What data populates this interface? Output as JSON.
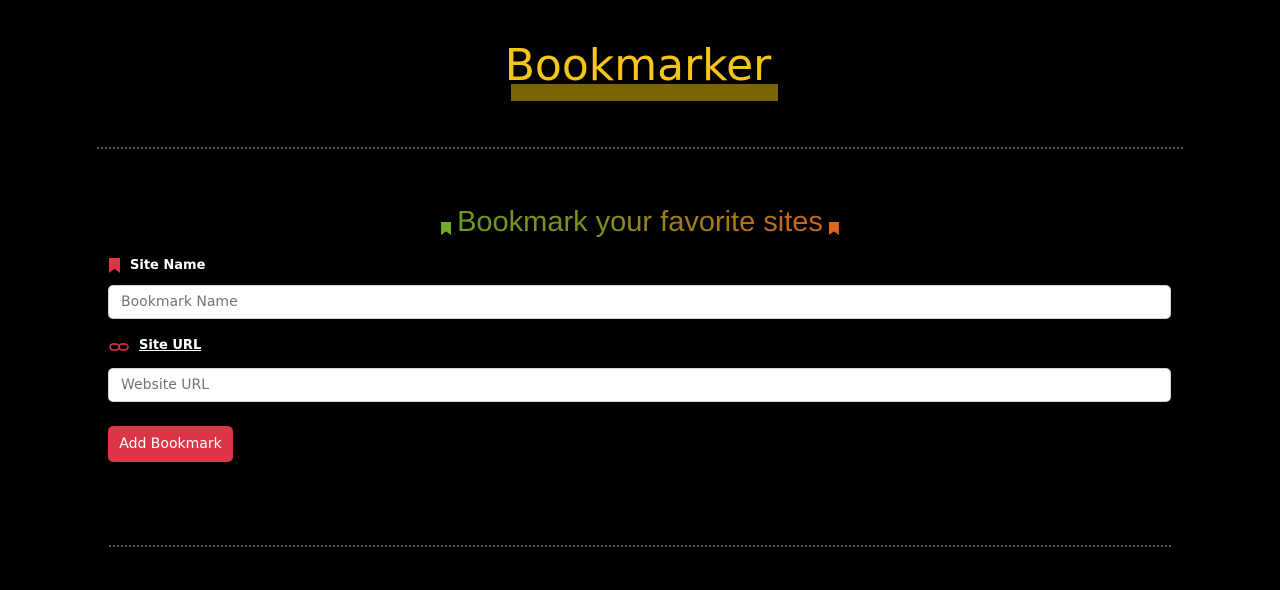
{
  "header": {
    "brand": "Bookmarker"
  },
  "form": {
    "subtitle": "Bookmark your favorite sites",
    "site_name": {
      "label": "Site Name",
      "placeholder": "Bookmark Name",
      "icon": "bookmark-icon"
    },
    "site_url": {
      "label": "Site URL",
      "placeholder": "Website URL",
      "icon": "link-icon"
    },
    "submit_label": "Add Bookmark"
  },
  "colors": {
    "background": "#000000",
    "brand": "#f5c518",
    "brand_underline": "#7a6405",
    "accent": "#dc3545",
    "subtitle_start": "#6c9a1d",
    "subtitle_end": "#c96419"
  }
}
